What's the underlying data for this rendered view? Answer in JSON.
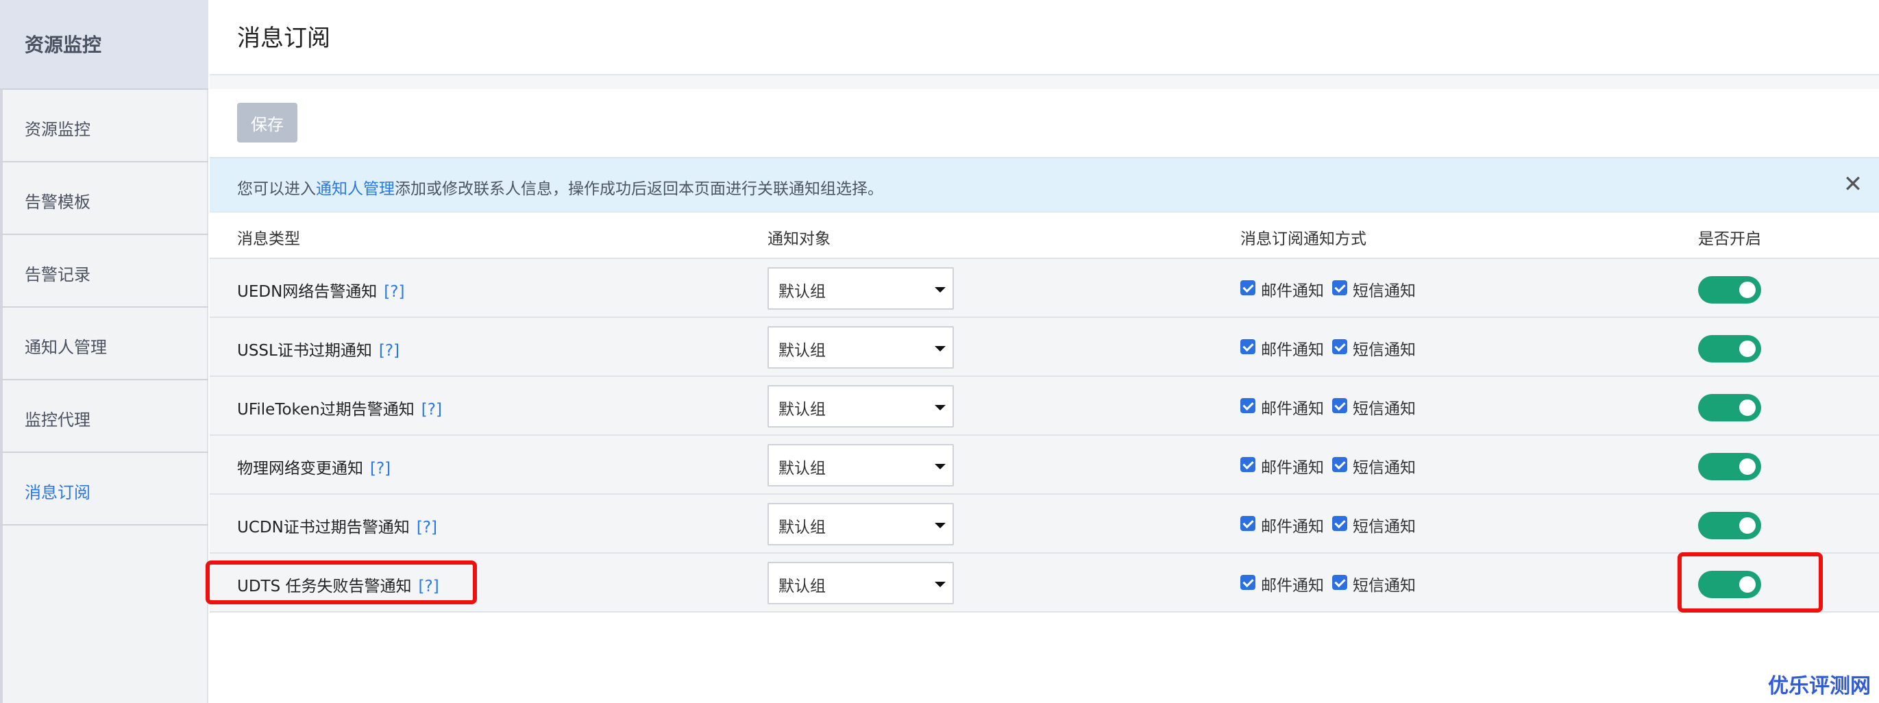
{
  "sidebar": {
    "header": "资源监控",
    "items": [
      {
        "label": "资源监控",
        "active": false
      },
      {
        "label": "告警模板",
        "active": false
      },
      {
        "label": "告警记录",
        "active": false
      },
      {
        "label": "通知人管理",
        "active": false
      },
      {
        "label": "监控代理",
        "active": false
      },
      {
        "label": "消息订阅",
        "active": true
      }
    ]
  },
  "page": {
    "title": "消息订阅"
  },
  "toolbar": {
    "save_label": "保存"
  },
  "notice": {
    "prefix": "您可以进入",
    "link": "通知人管理",
    "suffix": "添加或修改联系人信息，操作成功后返回本页面进行关联通知组选择。",
    "close_icon": "close-icon"
  },
  "table": {
    "headers": [
      "消息类型",
      "通知对象",
      "消息订阅通知方式",
      "是否开启"
    ],
    "help_label": "[?]",
    "email_label": "邮件通知",
    "sms_label": "短信通知",
    "rows": [
      {
        "type": "UEDN网络告警通知",
        "target": "默认组",
        "email": true,
        "sms": true,
        "enabled": true
      },
      {
        "type": "USSL证书过期通知",
        "target": "默认组",
        "email": true,
        "sms": true,
        "enabled": true
      },
      {
        "type": "UFileToken过期告警通知",
        "target": "默认组",
        "email": true,
        "sms": true,
        "enabled": true
      },
      {
        "type": "物理网络变更通知",
        "target": "默认组",
        "email": true,
        "sms": true,
        "enabled": true
      },
      {
        "type": "UCDN证书过期告警通知",
        "target": "默认组",
        "email": true,
        "sms": true,
        "enabled": true
      },
      {
        "type": "UDTS 任务失败告警通知",
        "target": "默认组",
        "email": true,
        "sms": true,
        "enabled": true
      }
    ]
  },
  "watermark": "优乐评测网",
  "colors": {
    "accent": "#2878e8",
    "toggle_on": "#1aa277",
    "highlight": "#ef0f0f",
    "notice_bg": "#e1f1fb"
  }
}
